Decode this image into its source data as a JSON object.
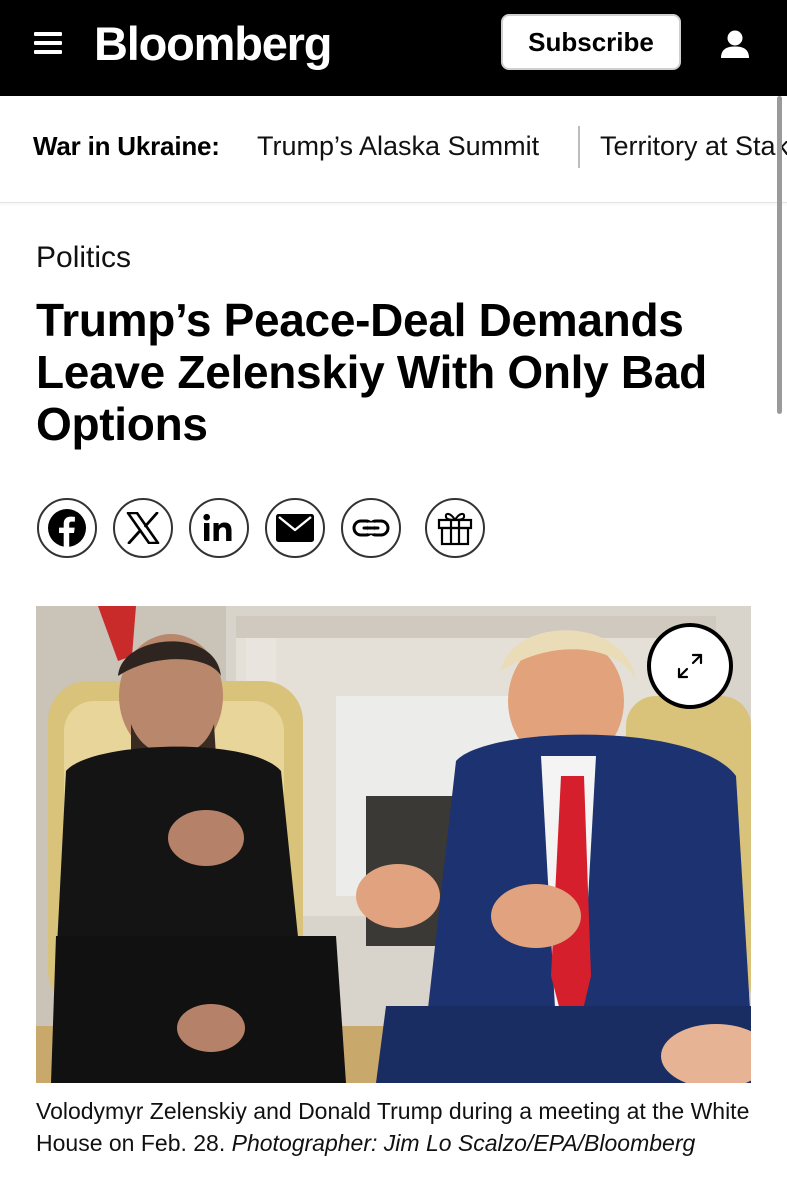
{
  "header": {
    "logo": "Bloomberg",
    "subscribe_label": "Subscribe",
    "menu_icon": "hamburger-menu-icon",
    "account_icon": "user-account-icon",
    "background": "#000000"
  },
  "subnav": {
    "label": "War in Ukraine:",
    "links": [
      "Trump’s Alaska Summit",
      "Territory at Stake"
    ]
  },
  "article": {
    "section": "Politics",
    "headline": "Trump’s Peace-Deal Demands Leave Zelenskiy With Only Bad Options",
    "share_icons": [
      "facebook-icon",
      "x-icon",
      "linkedin-icon",
      "email-icon",
      "copy-link-icon",
      "gift-icon"
    ],
    "image": {
      "expand_icon": "expand-icon"
    },
    "caption": {
      "text": "Volodymyr Zelenskiy and Donald Trump during a meeting at the White House on Feb. 28.",
      "credit": "Photographer: Jim Lo Scalzo/EPA/Bloomberg"
    }
  }
}
